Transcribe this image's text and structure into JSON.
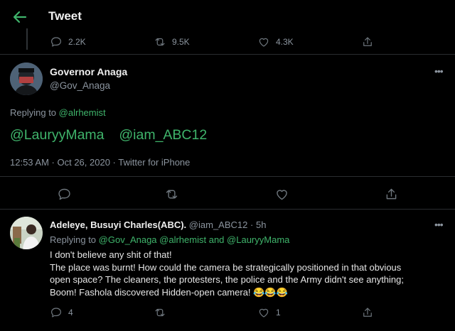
{
  "header": {
    "title": "Tweet",
    "back_icon": "arrow-left-icon"
  },
  "prev_tweet": {
    "replies": "2.2K",
    "retweets": "9.5K",
    "likes": "4.3K"
  },
  "main_tweet": {
    "name": "Governor Anaga",
    "handle": "@Gov_Anaga",
    "replying_prefix": "Replying to",
    "replying_to": "@alrhemist",
    "mention_1": "@LauryyMama",
    "mention_2": "@iam_ABC12",
    "timestamp": "12:53 AM · Oct 26, 2020 · Twitter for iPhone"
  },
  "reply": {
    "name": "Adeleye, Busuyi Charles(ABC).",
    "handle": "@iam_ABC12",
    "sep": "·",
    "age": "5h",
    "replying_prefix": "Replying to",
    "replying_1": "@Gov_Anaga",
    "replying_2": "@alrhemist",
    "and": "and",
    "replying_3": "@LauryyMama",
    "line_1": "I don't believe any shit of that!",
    "line_2": "The place was burnt! How could the camera be strategically positioned in that obvious",
    "line_3": "open space? The cleaners, the protesters, the police and the Army didn't see anything;",
    "line_4": "Boom! Fashola discovered Hidden-open camera!",
    "emoji": "😂😂😂",
    "replies": "4",
    "likes": "1"
  },
  "colors": {
    "background": "#000000",
    "accent": "#3fb46b",
    "text": "#d9d9d9",
    "muted": "#8b949e"
  }
}
